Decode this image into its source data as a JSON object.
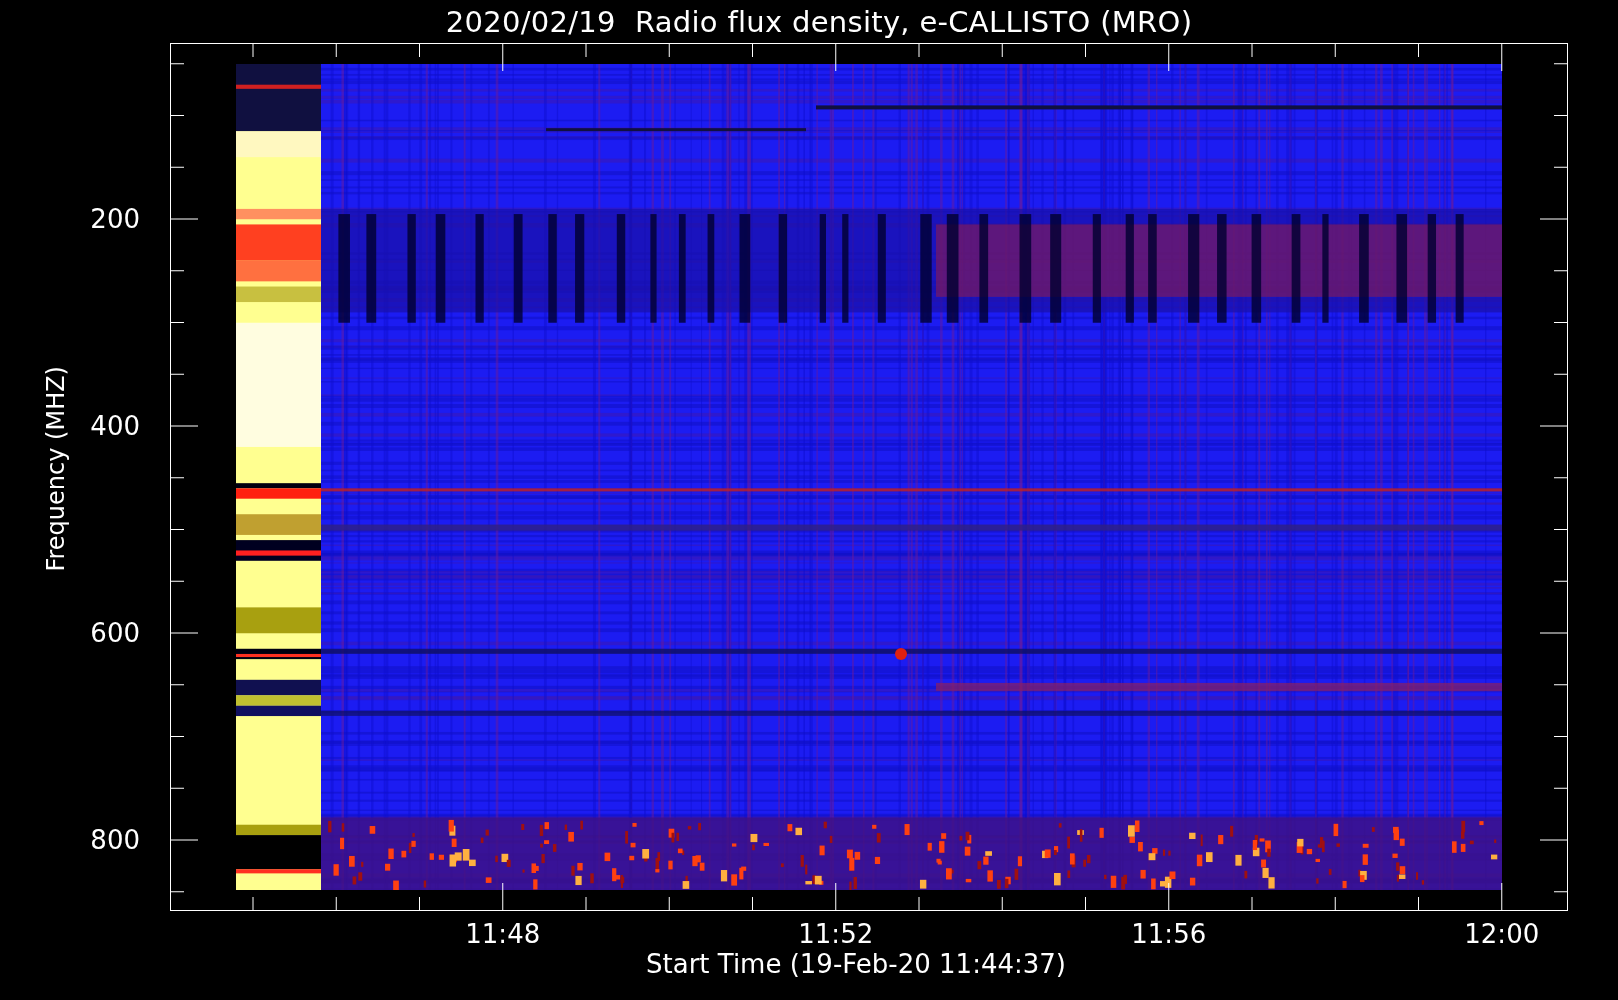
{
  "title": "2020/02/19  Radio flux density, e-CALLISTO (MRO)",
  "y_axis": {
    "label": "Frequency (MHZ)",
    "ticks": [
      "200",
      "400",
      "600",
      "800"
    ]
  },
  "x_axis": {
    "label": "Start Time (19-Feb-20 11:44:37)",
    "ticks": [
      "11:48",
      "11:52",
      "11:56",
      "12:00"
    ]
  }
}
